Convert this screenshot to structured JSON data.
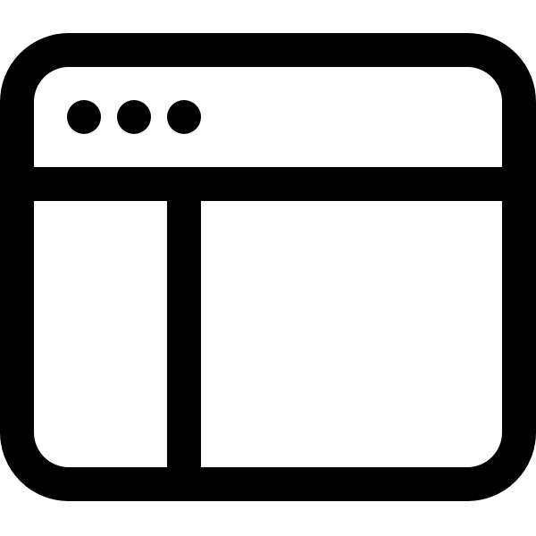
{
  "icon": {
    "name": "browser-window-sidebar-icon",
    "stroke_color": "#000000",
    "background_color": "#ffffff"
  }
}
